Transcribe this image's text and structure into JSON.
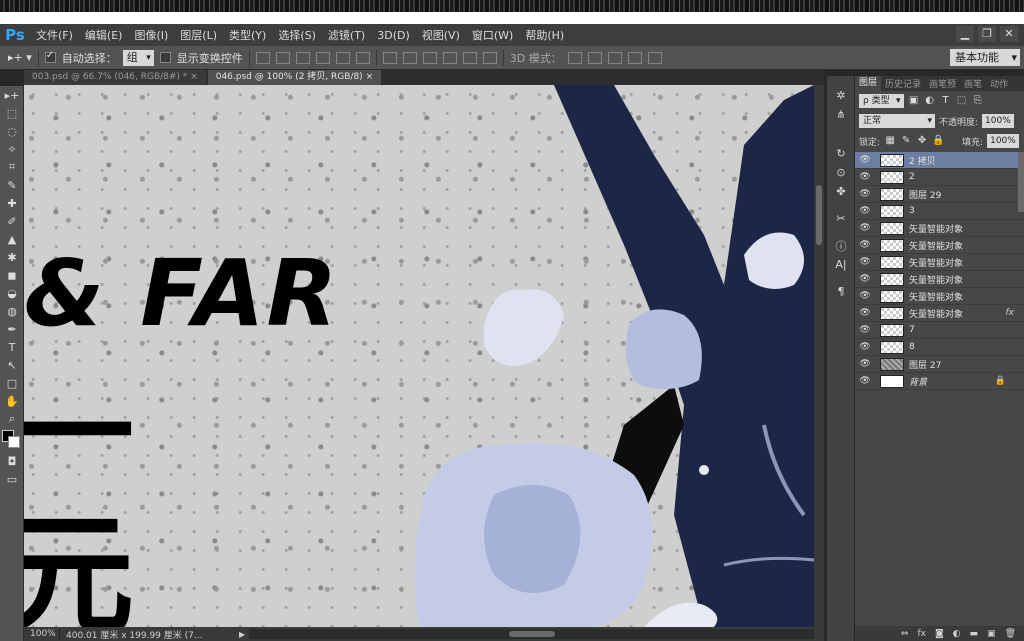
{
  "app": {
    "logo": "Ps"
  },
  "menu": [
    "文件(F)",
    "编辑(E)",
    "图像(I)",
    "图层(L)",
    "类型(Y)",
    "选择(S)",
    "滤镜(T)",
    "3D(D)",
    "视图(V)",
    "窗口(W)",
    "帮助(H)"
  ],
  "window_controls": [
    "▁",
    "❐",
    "✕"
  ],
  "options": {
    "move_icon": "▸+ ▾",
    "auto_select_label": "自动选择：",
    "auto_select_checked": true,
    "auto_select_target": "组",
    "show_transform_label": "显示变换控件",
    "show_transform_checked": false,
    "mode_3d_label": "3D 模式：",
    "workspace": "基本功能"
  },
  "tabs": [
    {
      "label": "003.psd @ 66.7% (046, RGB/8#) *",
      "active": false,
      "close": "×"
    },
    {
      "label": "046.psd @ 100% (2 拷贝, RGB/8)",
      "active": true,
      "close": "×"
    }
  ],
  "canvas": {
    "text_line1": "& FAR",
    "text_line2": "一",
    "text_line3": "元",
    "text_color": "#000000",
    "figure_color": "#1c2745",
    "splash_color": "#b4bedc"
  },
  "status": {
    "zoom": "100%",
    "doc_info": "400.01 厘米 x 199.99 厘米 (7...",
    "play": "▶"
  },
  "layers_panel": {
    "tabs": [
      "图层",
      "历史记录",
      "画笔预",
      "画笔",
      "动作"
    ],
    "kind_filter": "ρ 类型",
    "blend_mode": "正常",
    "opacity_label": "不透明度:",
    "opacity_value": "100%",
    "lock_label": "锁定:",
    "fill_label": "填充:",
    "fill_value": "100%",
    "layers": [
      {
        "name": "2 拷贝",
        "selected": true,
        "thumb": "checker",
        "fx": "",
        "lock": ""
      },
      {
        "name": "2",
        "selected": false,
        "thumb": "checker",
        "fx": "",
        "lock": ""
      },
      {
        "name": "图层 29",
        "selected": false,
        "thumb": "checker",
        "fx": "",
        "lock": ""
      },
      {
        "name": "3",
        "selected": false,
        "thumb": "checker",
        "fx": "",
        "lock": ""
      },
      {
        "name": "矢量智能对象",
        "selected": false,
        "thumb": "checker",
        "fx": "",
        "lock": ""
      },
      {
        "name": "矢量智能对象",
        "selected": false,
        "thumb": "checker",
        "fx": "",
        "lock": ""
      },
      {
        "name": "矢量智能对象",
        "selected": false,
        "thumb": "checker",
        "fx": "",
        "lock": ""
      },
      {
        "name": "矢量智能对象",
        "selected": false,
        "thumb": "checker",
        "fx": "",
        "lock": ""
      },
      {
        "name": "矢量智能对象",
        "selected": false,
        "thumb": "checker",
        "fx": "",
        "lock": ""
      },
      {
        "name": "矢量智能对象",
        "selected": false,
        "thumb": "checker",
        "fx": "fx",
        "lock": ""
      },
      {
        "name": "7",
        "selected": false,
        "thumb": "checker",
        "fx": "",
        "lock": ""
      },
      {
        "name": "8",
        "selected": false,
        "thumb": "checker",
        "fx": "",
        "lock": ""
      },
      {
        "name": "图层 27",
        "selected": false,
        "thumb": "texture",
        "fx": "",
        "lock": ""
      },
      {
        "name": "背景",
        "selected": false,
        "thumb": "white",
        "fx": "",
        "lock": "🔒"
      }
    ],
    "footer_icons": [
      "⇔",
      "fx",
      "◙",
      "◐",
      "▬",
      "▣",
      "🗑"
    ]
  },
  "tools": [
    "▸+",
    "⬚",
    "◌",
    "✧",
    "⌗",
    "✎",
    "✚",
    "✐",
    "▲",
    "✱",
    "◼",
    "◒",
    "◍",
    "✒",
    "T",
    "↖",
    "□",
    "✋",
    "⌕"
  ],
  "right_icons": [
    "✲",
    "⋔",
    "↻",
    "⊙",
    "✤",
    "✂",
    "ⓘ",
    "A|",
    "¶"
  ]
}
